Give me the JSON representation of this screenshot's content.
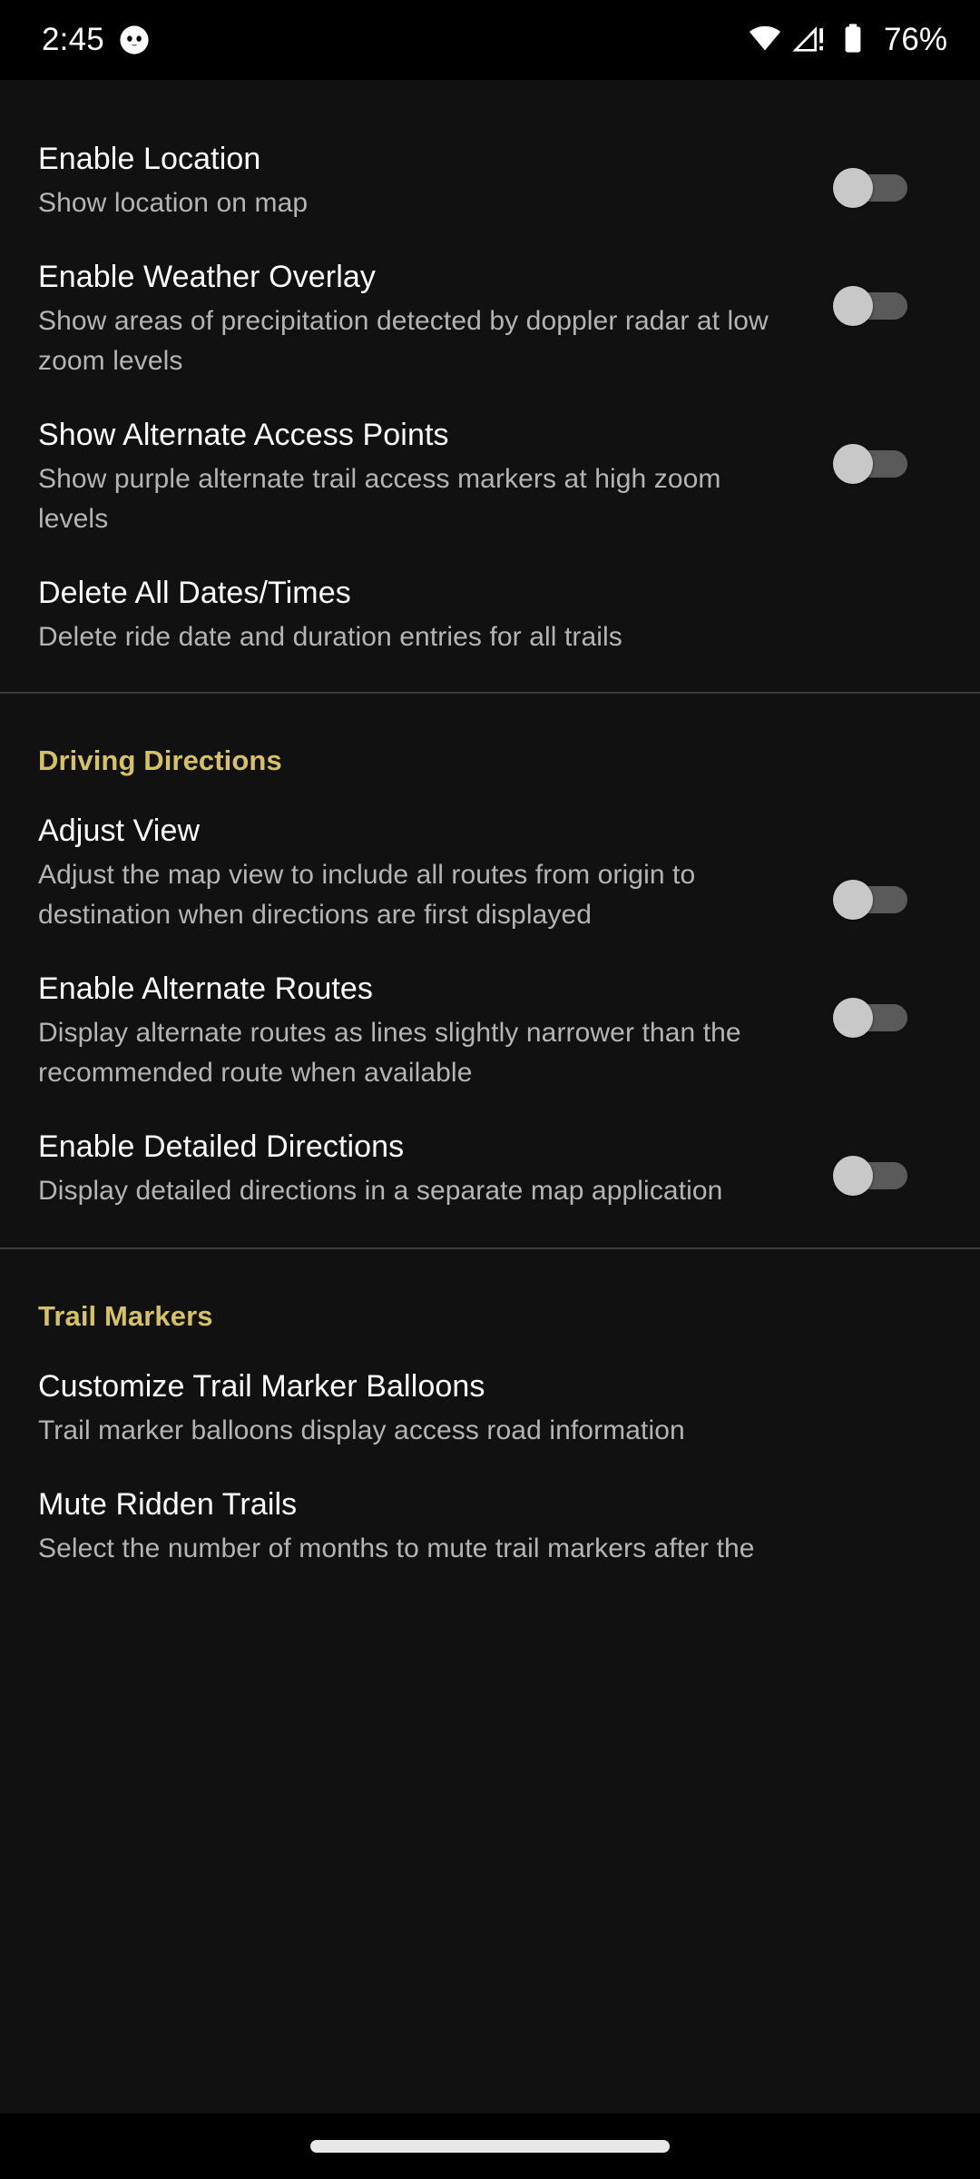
{
  "status_bar": {
    "time": "2:45",
    "battery_percent": "76%",
    "icons": [
      "cat-app-notification-icon",
      "wifi-icon",
      "cellular-signal-warning-icon",
      "battery-icon"
    ]
  },
  "colors": {
    "background": "#111111",
    "status_bar_background": "#000000",
    "section_header_accent": "#d6c264",
    "title_text": "#ffffff",
    "summary_text": "#b4b4b4",
    "divider": "#3b3b3b",
    "switch_track_off": "#5a5a5a",
    "switch_thumb_off": "#c8c8c8"
  },
  "sections": [
    {
      "header": null,
      "items": [
        {
          "title": "Enable Location",
          "summary": "Show location on map",
          "has_switch": true,
          "switch_state": "off",
          "width_class": "w-wide"
        },
        {
          "title": "Enable Weather Overlay",
          "summary": "Show areas of precipitation detected by doppler radar at low zoom levels",
          "has_switch": true,
          "switch_state": "off",
          "width_class": "w-mid"
        },
        {
          "title": "Show Alternate Access Points",
          "summary": "Show purple alternate trail access markers at high zoom levels",
          "has_switch": true,
          "switch_state": "off",
          "width_class": "w-mid"
        },
        {
          "title": "Delete All Dates/Times",
          "summary": "Delete ride date and duration entries for all trails",
          "has_switch": false,
          "switch_state": null,
          "width_class": "w-full"
        }
      ]
    },
    {
      "header": "Driving Directions",
      "items": [
        {
          "title": "Adjust View",
          "summary": "Adjust the map view to include all routes from origin to destination when directions are first displayed",
          "has_switch": true,
          "switch_state": "off",
          "width_class": "w-narrow"
        },
        {
          "title": "Enable Alternate Routes",
          "summary": "Display alternate routes as lines slightly narrower than the recommended route when available",
          "has_switch": true,
          "switch_state": "off",
          "width_class": "w-mid"
        },
        {
          "title": "Enable Detailed Directions",
          "summary": "Display detailed directions in a separate map application",
          "has_switch": true,
          "switch_state": "off",
          "width_class": "w-narrow"
        }
      ]
    },
    {
      "header": "Trail Markers",
      "items": [
        {
          "title": "Customize Trail Marker Balloons",
          "summary": "Trail marker balloons display access road information",
          "has_switch": false,
          "switch_state": null,
          "width_class": "w-full"
        },
        {
          "title": "Mute Ridden Trails",
          "summary": "Select the number of months to mute trail markers after the",
          "has_switch": false,
          "switch_state": null,
          "width_class": "w-full"
        }
      ]
    }
  ],
  "nav_bar": {
    "gesture_pill": "home-gesture-pill"
  }
}
